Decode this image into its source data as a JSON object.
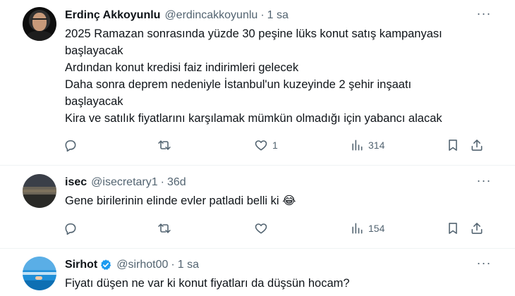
{
  "tweets": [
    {
      "name": "Erdinç Akkoyunlu",
      "handle": "@erdincakkoyunlu",
      "time": "1 sa",
      "lines": [
        "2025 Ramazan sonrasında yüzde 30 peşine lüks konut satış kampanyası",
        "başlayacak",
        "Ardından konut kredisi faiz indirimleri gelecek",
        "Daha sonra deprem nedeniyle İstanbul'un kuzeyinde 2 şehir inşaatı",
        "başlayacak",
        "Kira ve satılık fiyatlarını karşılamak mümkün olmadığı için yabancı alacak"
      ],
      "likes": "1",
      "views": "314"
    },
    {
      "name": "isec",
      "handle": "@isecretary1",
      "time": "36d",
      "lines": [
        "Gene birilerinin elinde evler patladi belli ki 😂"
      ],
      "likes": "",
      "views": "154"
    },
    {
      "name": "Sirhot",
      "handle": "@sirhot00",
      "time": "1 sa",
      "verified": true,
      "lines": [
        "Fiyatı düşen ne var ki konut fiyatları da düşsün hocam?"
      ]
    }
  ],
  "dot": "·",
  "more_label": "···",
  "icons": [
    "reply-icon",
    "retweet-icon",
    "like-icon",
    "views-icon",
    "bookmark-icon",
    "share-icon",
    "verified-badge-icon"
  ],
  "colors": {
    "text": "#0f1419",
    "secondary": "#536471",
    "divider": "#eff3f4",
    "verified": "#1d9bf0"
  }
}
